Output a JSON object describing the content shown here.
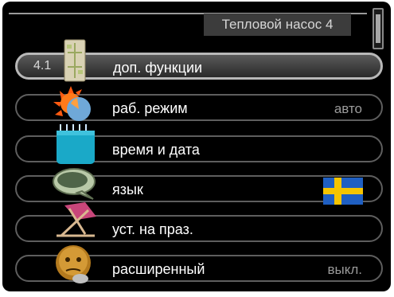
{
  "header": {
    "title": "Тепловой насос 4"
  },
  "menu": {
    "items": [
      {
        "number": "4.1",
        "label": "доп. функции",
        "value": "",
        "icon": "modules-icon",
        "selected": true
      },
      {
        "number": "",
        "label": "раб. режим",
        "value": "авто",
        "icon": "operating-mode-icon",
        "selected": false
      },
      {
        "number": "",
        "label": "время и дата",
        "value": "",
        "icon": "calendar-icon",
        "selected": false
      },
      {
        "number": "",
        "label": "язык",
        "value": "",
        "icon": "speech-bubble-icon",
        "selected": false
      },
      {
        "number": "",
        "label": "уст. на праз.",
        "value": "",
        "icon": "deck-chair-icon",
        "selected": false
      },
      {
        "number": "",
        "label": "расширенный",
        "value": "выкл.",
        "icon": "thinking-face-icon",
        "selected": false
      }
    ]
  },
  "colors": {
    "background": "#000000",
    "selected_row": "#4a4a4a",
    "flag_blue": "#1f5fc2",
    "flag_yellow": "#f5c400"
  }
}
